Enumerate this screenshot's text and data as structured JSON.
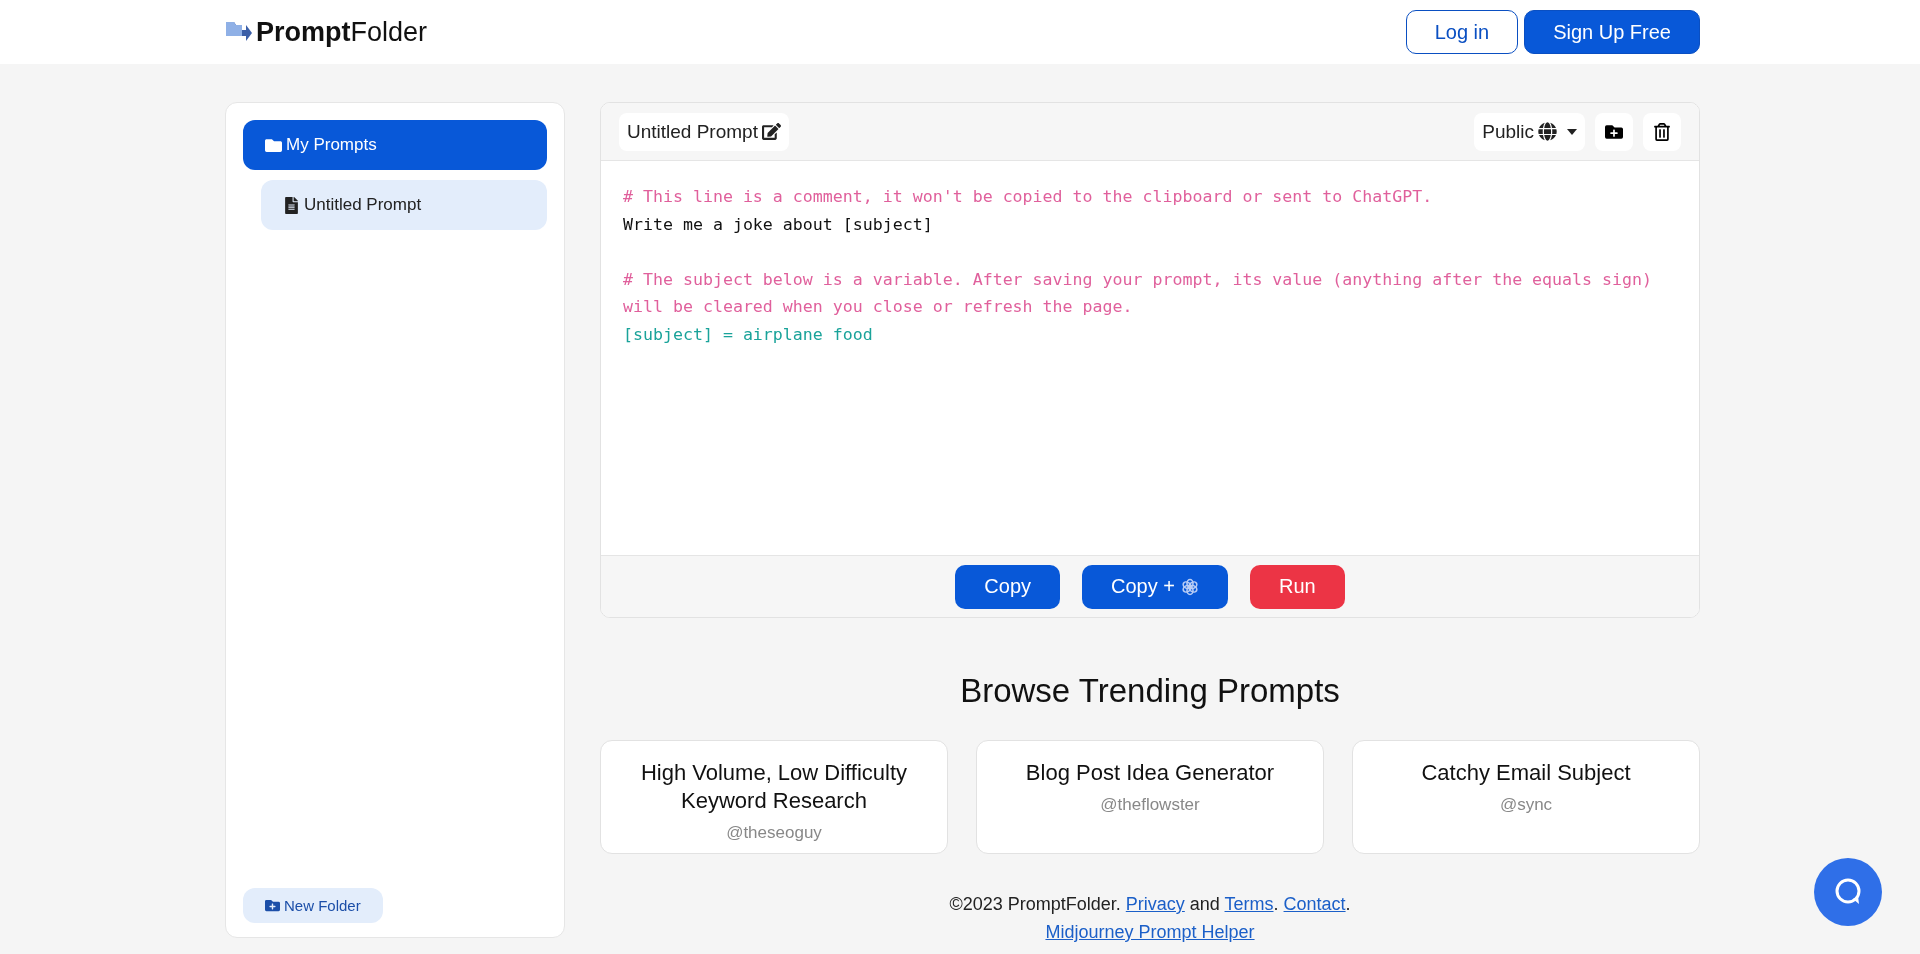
{
  "header": {
    "logo_bold": "Prompt",
    "logo_rest": "Folder",
    "buttons": [
      {
        "label": "Log in",
        "kind": "outline"
      },
      {
        "label": "Sign Up Free",
        "kind": "solid"
      }
    ]
  },
  "sidebar": {
    "items": [
      {
        "label": "My Prompts",
        "kind": "folder",
        "selected": true,
        "children": [
          {
            "label": "Untitled Prompt",
            "kind": "prompt",
            "selected": false
          }
        ]
      }
    ],
    "new_folder": "New Folder"
  },
  "editor": {
    "title": "Untitled Prompt",
    "visibility": "Public",
    "lines": [
      {
        "kind": "comment",
        "text": "# This line is a comment, it won't be copied to the clipboard or sent to ChatGPT."
      },
      {
        "kind": "text",
        "text": "Write me a joke about [subject]"
      },
      {
        "kind": "blank"
      },
      {
        "kind": "comment",
        "text": "# The subject below is a variable. After saving your prompt, its value (anything after the equals sign)"
      },
      {
        "kind": "comment",
        "text": "will be cleared when you close or refresh the page."
      },
      {
        "kind": "variable",
        "text": "[subject] = airplane food"
      }
    ],
    "actions": [
      {
        "label": "Copy",
        "kind": "primary",
        "icon": false
      },
      {
        "label": "Copy +",
        "kind": "primary",
        "icon": true
      },
      {
        "label": "Run",
        "kind": "danger",
        "icon": false
      }
    ]
  },
  "trending": {
    "title": "Browse Trending Prompts",
    "cards": [
      {
        "title": "High Volume, Low Difficulty Keyword Research",
        "author": "@theseoguy"
      },
      {
        "title": "Blog Post Idea Generator",
        "author": "@theflowster"
      },
      {
        "title": "Catchy Email Subject",
        "author": "@sync"
      }
    ]
  },
  "footer": {
    "copyright": "©2023 PromptFolder.",
    "links": [
      {
        "label": "Privacy",
        "after": " and "
      },
      {
        "label": "Terms",
        "after": ". "
      },
      {
        "label": "Contact",
        "after": "."
      }
    ],
    "helper": "Midjourney Prompt Helper"
  }
}
